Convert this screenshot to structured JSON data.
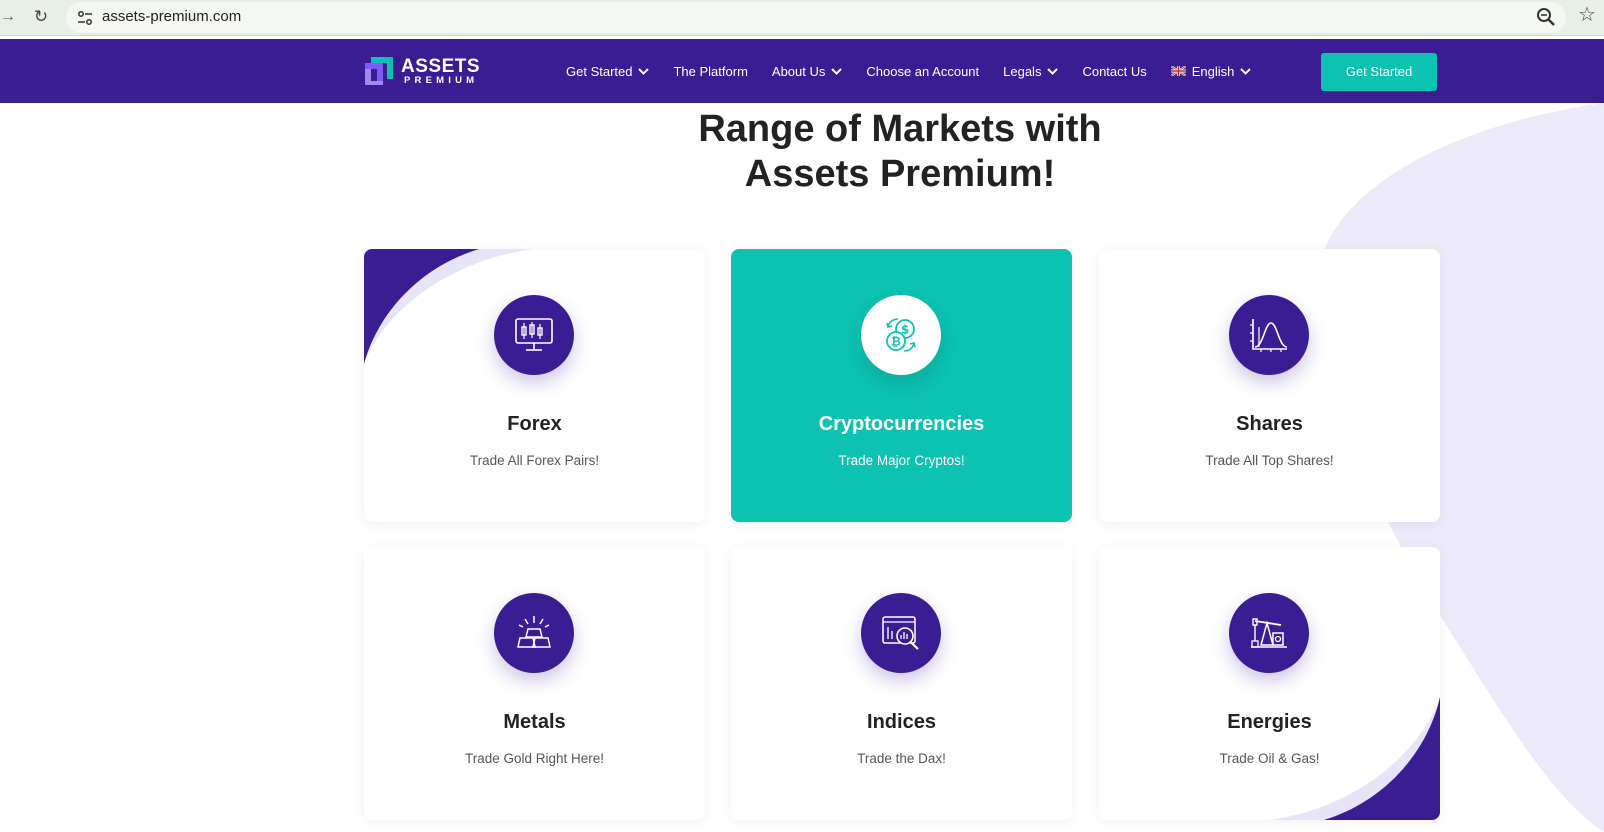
{
  "browser": {
    "url": "assets-premium.com"
  },
  "header": {
    "logo": {
      "line1": "ASSETS",
      "line2": "PREMIUM"
    },
    "menu": [
      {
        "label": "Get Started",
        "dropdown": true
      },
      {
        "label": "The Platform",
        "dropdown": false
      },
      {
        "label": "About Us",
        "dropdown": true
      },
      {
        "label": "Choose an Account",
        "dropdown": false
      },
      {
        "label": "Legals",
        "dropdown": true
      },
      {
        "label": "Contact Us",
        "dropdown": false
      },
      {
        "label": "English",
        "dropdown": true,
        "flag": "uk-flag-icon"
      }
    ],
    "cta_label": "Get Started"
  },
  "main": {
    "heading_line1": "Range of Markets with",
    "heading_line2": "Assets Premium!",
    "cards": [
      {
        "title": "Forex",
        "subtitle": "Trade All Forex Pairs!",
        "icon": "forex-chart-icon",
        "active": false
      },
      {
        "title": "Cryptocurrencies",
        "subtitle": "Trade Major Cryptos!",
        "icon": "crypto-exchange-icon",
        "active": true
      },
      {
        "title": "Shares",
        "subtitle": "Trade All Top Shares!",
        "icon": "bell-curve-chart-icon",
        "active": false
      },
      {
        "title": "Metals",
        "subtitle": "Trade Gold Right Here!",
        "icon": "gold-bars-icon",
        "active": false
      },
      {
        "title": "Indices",
        "subtitle": "Trade the Dax!",
        "icon": "index-magnifier-icon",
        "active": false
      },
      {
        "title": "Energies",
        "subtitle": "Trade Oil & Gas!",
        "icon": "oil-pump-icon",
        "active": false
      }
    ]
  },
  "colors": {
    "brand_purple": "#3a1d92",
    "accent_teal": "#0cc2b1",
    "bg_lavender": "#eceaf9"
  }
}
